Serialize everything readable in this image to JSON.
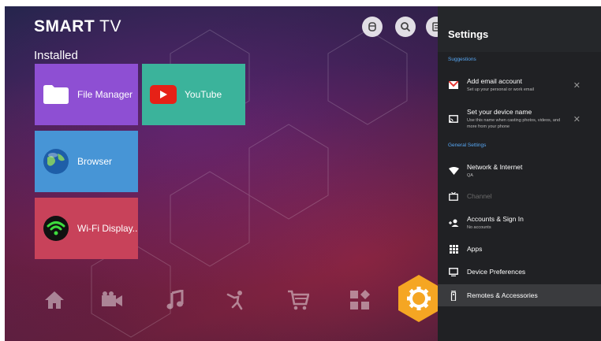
{
  "brand": {
    "bold": "SMART",
    "light": "TV"
  },
  "top_icons": [
    "input-source-icon",
    "search-icon",
    "notes-icon"
  ],
  "installed_label": "Installed",
  "apps": [
    {
      "label": "File Manager",
      "icon": "folder-icon",
      "color": "#8e4fd3"
    },
    {
      "label": "YouTube",
      "icon": "youtube-icon",
      "color": "#3bb39b"
    },
    {
      "label": "Browser",
      "icon": "globe-icon",
      "color": "#4795d6"
    },
    {
      "label": "Wi-Fi Display..",
      "icon": "wifi-icon",
      "color": "#c8425a"
    }
  ],
  "dock": [
    "home-icon",
    "video-icon",
    "music-icon",
    "sports-icon",
    "shopping-cart-icon",
    "apps-grid-icon",
    "settings-icon"
  ],
  "settings": {
    "title": "Settings",
    "suggestions_label": "Suggestions",
    "suggestions": [
      {
        "title": "Add email account",
        "subtitle": "Set up your personal or work email"
      },
      {
        "title": "Set your device name",
        "subtitle": "Use this name when casting photos, videos, and more from your phone"
      }
    ],
    "general_label": "General Settings",
    "items": [
      {
        "title": "Network & Internet",
        "subtitle": "QA"
      },
      {
        "title": "Channel",
        "subtitle": ""
      },
      {
        "title": "Accounts & Sign In",
        "subtitle": "No accounts"
      },
      {
        "title": "Apps",
        "subtitle": ""
      },
      {
        "title": "Device Preferences",
        "subtitle": ""
      },
      {
        "title": "Remotes & Accessories",
        "subtitle": ""
      }
    ]
  },
  "colors": {
    "panel_bg": "#202124",
    "section_label": "#57a8f5",
    "gear_hex": "#f5a623"
  }
}
